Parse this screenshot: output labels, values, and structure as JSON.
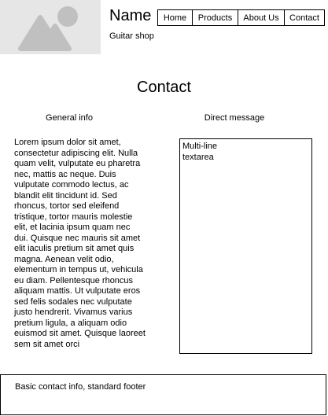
{
  "header": {
    "logo_icon": "image-placeholder-icon",
    "site_name": "Name",
    "tagline": "Guitar shop",
    "nav": [
      {
        "label": "Home"
      },
      {
        "label": "Products"
      },
      {
        "label": "About Us"
      },
      {
        "label": "Contact"
      }
    ]
  },
  "main": {
    "title": "Contact",
    "general_info": {
      "heading": "General info",
      "text": "Lorem ipsum dolor sit amet, consectetur adipiscing elit. Nulla quam velit, vulputate eu pharetra nec, mattis ac neque. Duis vulputate commodo lectus, ac blandit elit tincidunt id. Sed rhoncus, tortor sed eleifend tristique, tortor mauris molestie elit, et lacinia ipsum quam nec dui. Quisque nec mauris sit amet elit iaculis pretium sit amet quis magna. Aenean velit odio, elementum in tempus ut, vehicula eu diam. Pellentesque rhoncus aliquam mattis. Ut vulputate eros sed felis sodales nec vulputate justo hendrerit. Vivamus varius pretium ligula, a aliquam odio euismod sit amet. Quisque laoreet sem sit amet orci"
    },
    "direct_message": {
      "heading": "Direct message",
      "textarea_value": "Multi-line\ntextarea"
    }
  },
  "footer": {
    "text": "Basic contact info, standard footer"
  },
  "colors": {
    "logo_background": "#e6e6e6",
    "logo_glyph": "#c0c0c0",
    "border": "#000000"
  }
}
